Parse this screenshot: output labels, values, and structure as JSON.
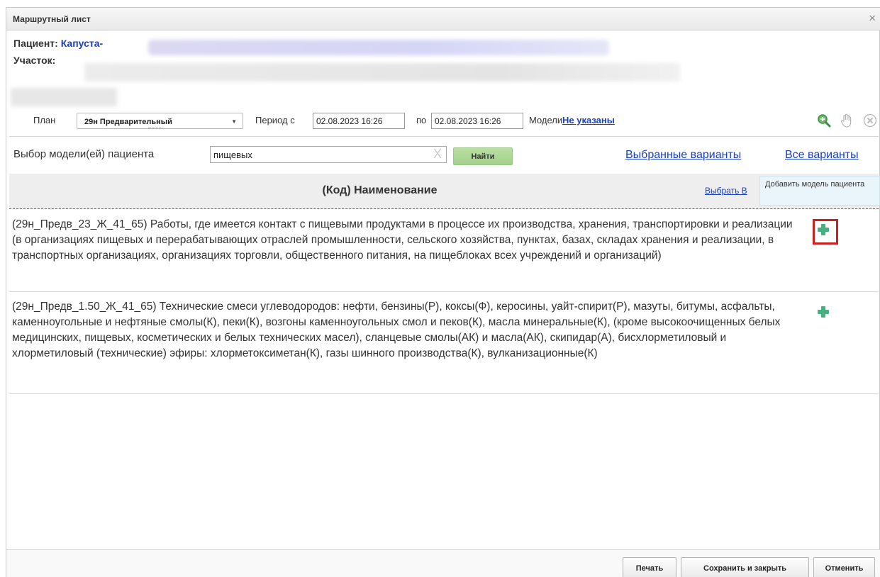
{
  "window": {
    "title": "Маршрутный лист",
    "close_symbol": "×"
  },
  "patient": {
    "label": "Пациент:",
    "name": "Капуста-"
  },
  "district": {
    "label": "Участок:"
  },
  "toolbar": {
    "plan_label": "План",
    "plan_value": "29н Предварительный",
    "period_from_label": "Период с",
    "period_from_value": "02.08.2023 16:26",
    "period_to_label": "по",
    "period_to_value": "02.08.2023 16:26",
    "models_label": "Модели:",
    "models_link": "Не указаны"
  },
  "search": {
    "label": "Выбор модели(ей) пациента",
    "value": "пищевых",
    "clear_symbol": "X",
    "find_button": "Найти",
    "selected_link": "Выбранные варианты",
    "all_link": "Все варианты"
  },
  "grid": {
    "header": "(Код) Наименование",
    "select_all_link": "Выбрать В",
    "tooltip": "Добавить модель пациента",
    "rows": [
      {
        "text": "(29н_Предв_23_Ж_41_65) Работы, где имеется контакт с пищевыми продуктами в процессе их производства, хранения, транспортировки и реализации (в организациях пищевых и перерабатывающих отраслей промышленности, сельского хозяйства, пунктах, базах, складах хранения и реализации, в транспортных организациях, организациях торговли, общественного питания, на пищеблоках всех учреждений и организаций)",
        "icon": "plus-icon",
        "highlighted": true
      },
      {
        "text": "(29н_Предв_1.50_Ж_41_65) Технические смеси углеводородов: нефти, бензины(Р), коксы(Ф), керосины, уайт-спирит(Р), мазуты, битумы, асфальты, каменноугольные и нефтяные смолы(К), пеки(К), возгоны каменноугольных смол и пеков(К), масла минеральные(К), (кроме высокоочищенных белых медицинских, пищевых, косметических и белых технических масел), сланцевые смолы(АК) и масла(АК), скипидар(А), бисхлорметиловый и хлорметиловый (технические) эфиры: хлорметоксиметан(К), газы шинного производства(К), вулканизационные(К)",
        "icon": "plus-icon",
        "highlighted": false
      }
    ]
  },
  "footer": {
    "print": "Печать",
    "save_close": "Сохранить и закрыть",
    "cancel": "Отменить"
  },
  "colors": {
    "link": "#1a3ec4",
    "add_icon": "#46b07e",
    "highlight": "#cc1f1f",
    "find_button": "#a4d18b"
  }
}
